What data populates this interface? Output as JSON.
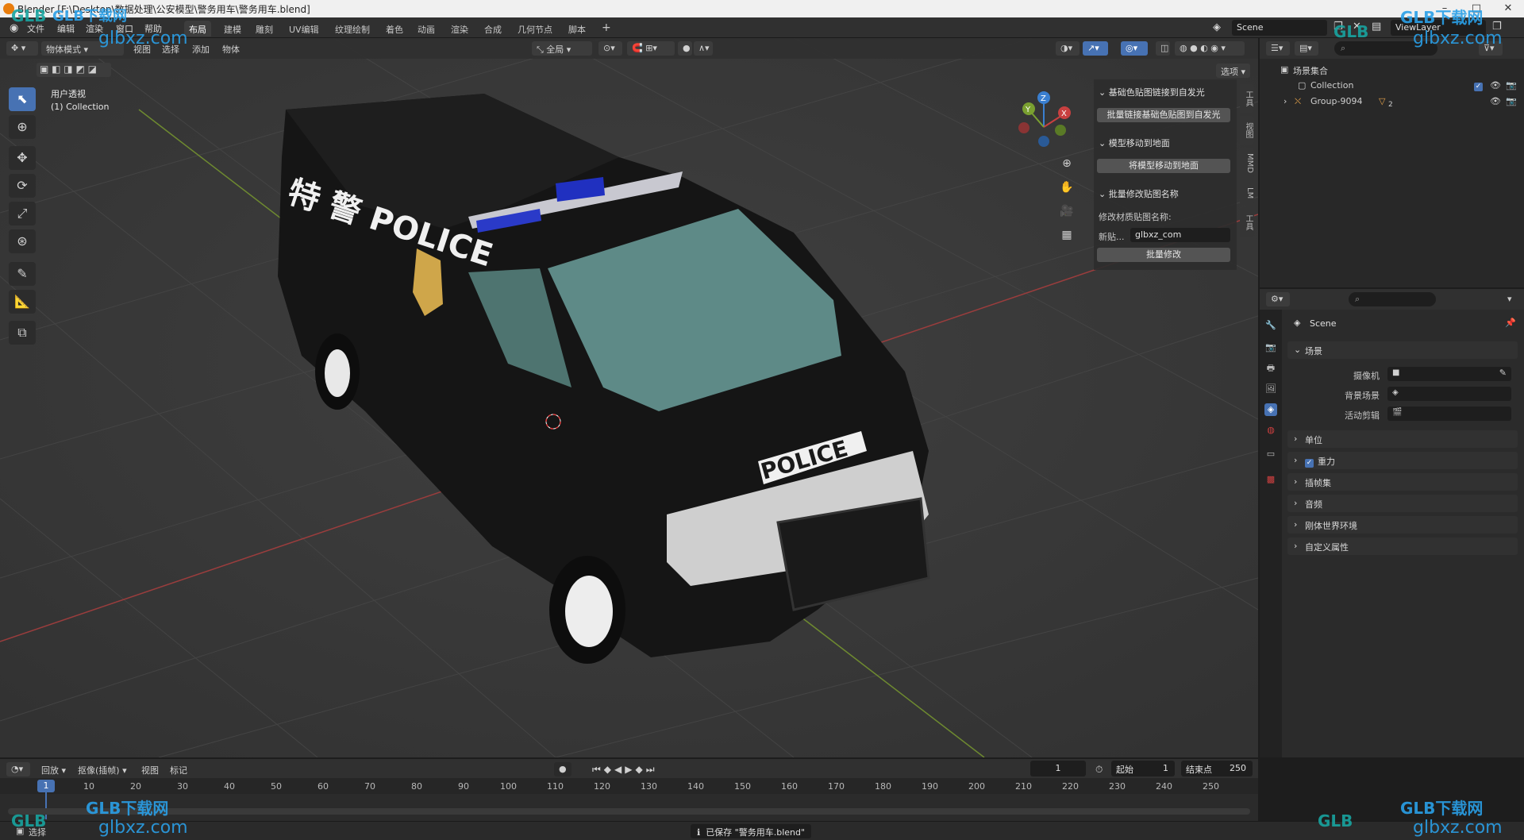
{
  "window": {
    "title": "Blender [F:\\Desktop\\数据处理\\公安模型\\警务用车\\警务用车.blend]"
  },
  "menu": [
    "文件",
    "编辑",
    "渲染",
    "窗口",
    "帮助"
  ],
  "workspaces": [
    {
      "label": "布局",
      "active": true
    },
    {
      "label": "建模"
    },
    {
      "label": "雕刻"
    },
    {
      "label": "UV编辑"
    },
    {
      "label": "纹理绘制"
    },
    {
      "label": "着色"
    },
    {
      "label": "动画"
    },
    {
      "label": "渲染"
    },
    {
      "label": "合成"
    },
    {
      "label": "几何节点"
    },
    {
      "label": "脚本"
    }
  ],
  "top_right": {
    "scene": "Scene",
    "view_layer": "ViewLayer"
  },
  "viewport_header": {
    "mode": "物体模式",
    "menus": [
      "视图",
      "选择",
      "添加",
      "物体"
    ],
    "orientation": "全局",
    "options_label": "选项"
  },
  "viewport": {
    "view_name": "用户透视",
    "collection": "(1) Collection",
    "gizmo": {
      "x": "X",
      "y": "Y",
      "z": "Z"
    },
    "decal_top": "特 警 POLICE",
    "decal_hood": "POLICE"
  },
  "n_panel": {
    "section1_title": "基础色贴图链接到自发光",
    "section1_button": "批量链接基础色贴图到自发光",
    "section2_title": "模型移动到地面",
    "section2_button": "将模型移动到地面",
    "section3_title": "批量修改贴图名称",
    "section3_label": "修改材质贴图名称:",
    "new_label": "新贴...",
    "new_value": "glbxz_com",
    "section3_button": "批量修改",
    "tabs": [
      "工具",
      "视图",
      "MMD",
      "LM",
      "工具"
    ]
  },
  "outliner": {
    "root": "场景集合",
    "items": [
      {
        "label": "Collection"
      },
      {
        "label": "Group-9094",
        "badge": "2"
      }
    ]
  },
  "properties": {
    "scene_name": "Scene",
    "section_scene": "场景",
    "camera_label": "摄像机",
    "bg_scene_label": "背景场景",
    "active_clip_label": "活动剪辑",
    "sections": [
      "单位",
      "重力",
      "插帧集",
      "音频",
      "刚体世界环境",
      "自定义属性"
    ]
  },
  "timeline": {
    "menus": [
      "回放",
      "抠像(插帧)",
      "视图",
      "标记"
    ],
    "current_frame": "1",
    "start_label": "起始",
    "start_value": "1",
    "end_label": "结束点",
    "end_value": "250",
    "ticks": [
      "1",
      "10",
      "20",
      "30",
      "40",
      "50",
      "60",
      "70",
      "80",
      "90",
      "100",
      "110",
      "120",
      "130",
      "140",
      "150",
      "160",
      "170",
      "180",
      "190",
      "200",
      "210",
      "220",
      "230",
      "240",
      "250"
    ]
  },
  "statusbar": {
    "left": "选择",
    "message": "已保存 \"警务用车.blend\""
  },
  "watermarks": {
    "brand": "GLB下载网",
    "domain": "glbxz.com",
    "logo": "GLB"
  },
  "colors": {
    "accent": "#4772b3",
    "viewport_bg": "#3a3a3a",
    "panel_bg": "#2b2b2b",
    "x_axis": "#b34a4a",
    "y_axis": "#7a9a3a"
  }
}
